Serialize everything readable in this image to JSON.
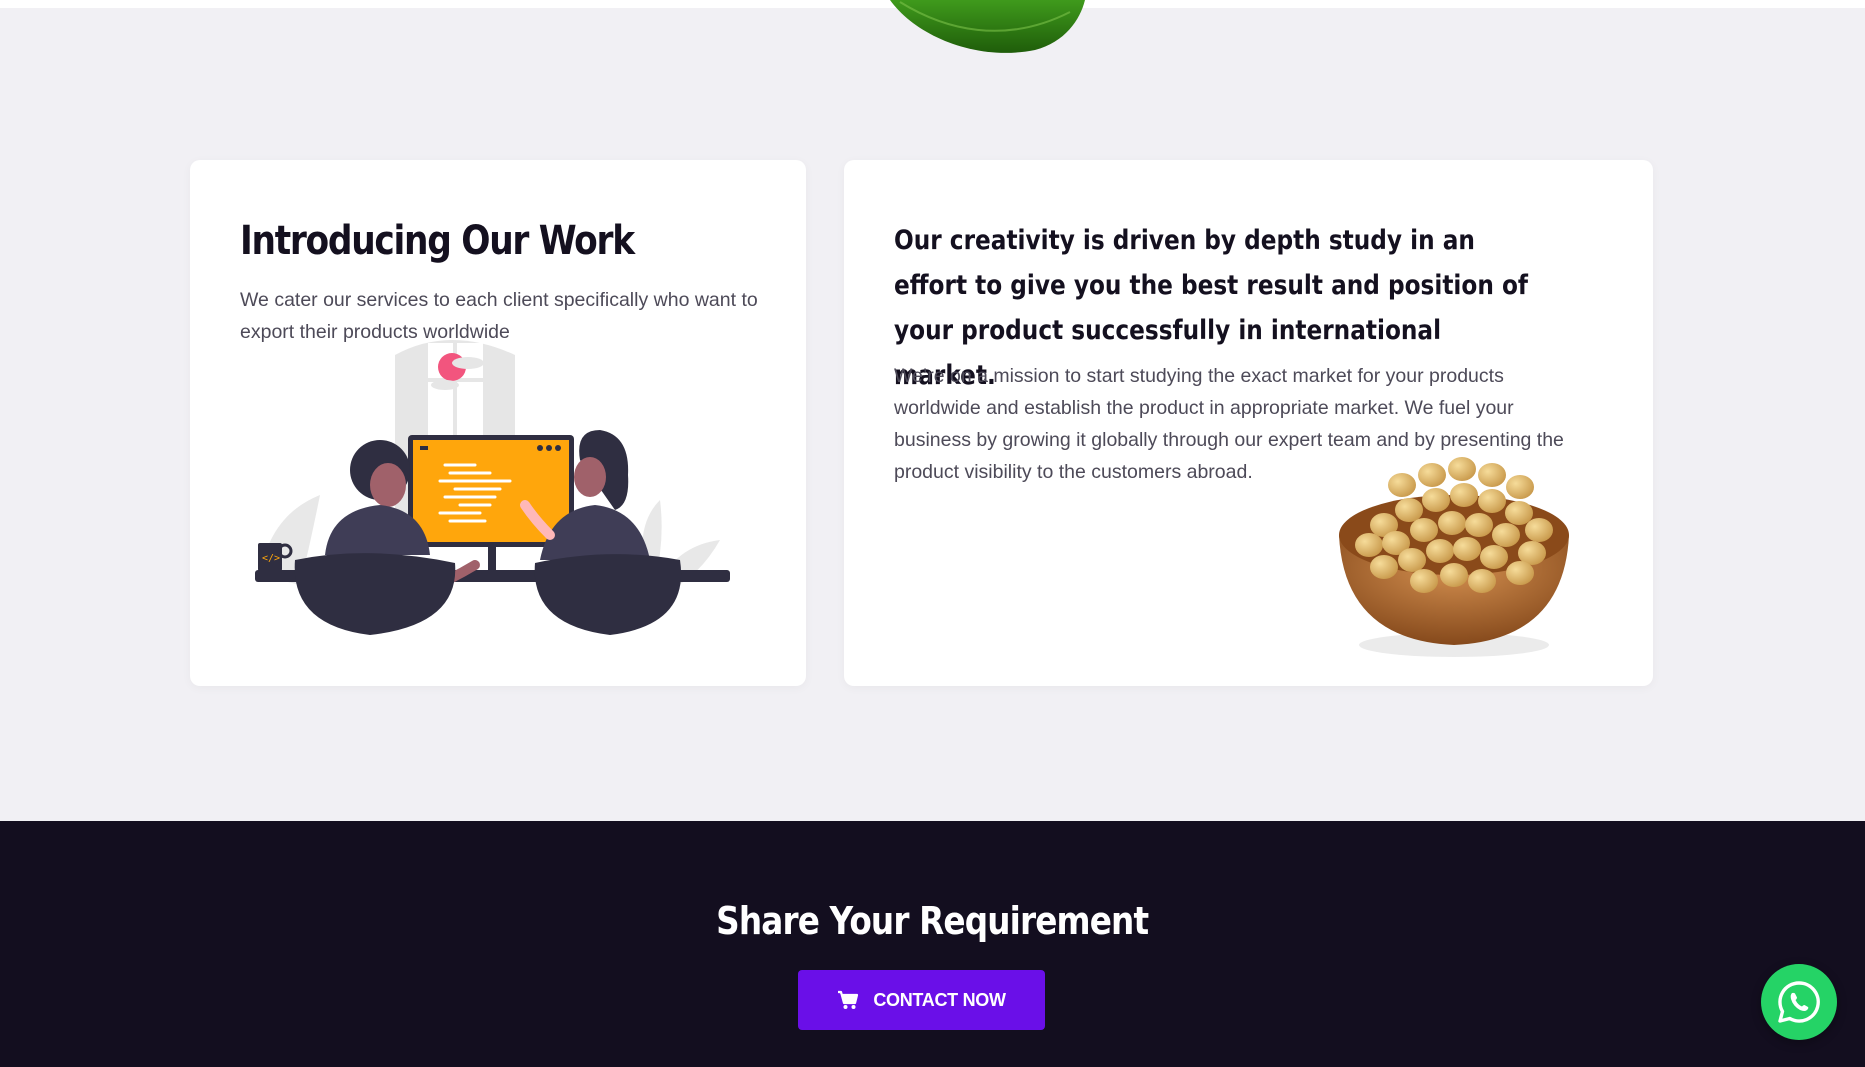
{
  "intro_card": {
    "title": "Introducing Our Work",
    "description": "We cater our services to each client specifically who want to export their products worldwide"
  },
  "mission_card": {
    "heading": "Our creativity is driven by depth study in an effort to give you the best result and position of your product successfully in international market.",
    "description": "We’re on a mission to start studying the exact market for your products worldwide and establish the product in appropriate market. We fuel your business by growing it globally through our expert team and by presenting the product visibility to the customers abroad."
  },
  "cta": {
    "title": "Share Your Requirement",
    "button_label": "CONTACT NOW"
  },
  "icons": {
    "cart": "cart-icon",
    "whatsapp": "whatsapp-icon",
    "leaf": "leaf-image",
    "bowl": "soybean-bowl-image",
    "illustration": "team-working-illustration"
  },
  "colors": {
    "background": "#f1f0f4",
    "dark_section": "#130e1f",
    "accent": "#6a0fe8",
    "whatsapp": "#25d366",
    "monitor": "#ffa60c"
  }
}
